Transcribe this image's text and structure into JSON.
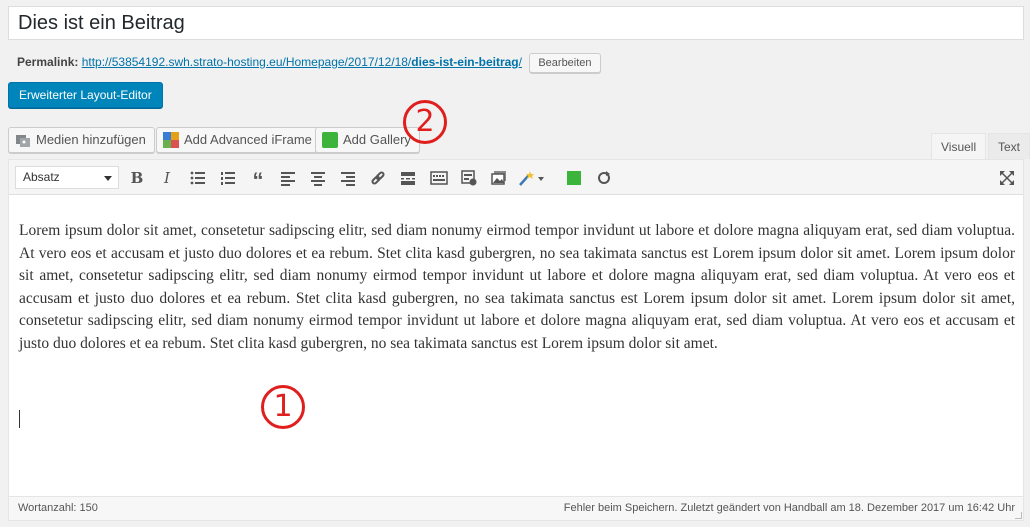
{
  "post": {
    "title": "Dies ist ein Beitrag",
    "permalink_label": "Permalink:",
    "permalink_base": "http://53854192.swh.strato-hosting.eu/Homepage/2017/12/18/",
    "permalink_slug": "dies-ist-ein-beitrag",
    "permalink_trailing": "/",
    "edit_slug_label": "Bearbeiten"
  },
  "layout_editor_label": "Erweiterter Layout-Editor",
  "media_buttons": {
    "add_media": "Medien hinzufügen",
    "add_iframe": "Add Advanced iFrame",
    "add_gallery": "Add Gallery"
  },
  "tabs": {
    "visual": "Visuell",
    "text": "Text"
  },
  "toolbar": {
    "format_select": "Absatz",
    "icons": [
      "bold-icon",
      "italic-icon",
      "bullet-list-icon",
      "numbered-list-icon",
      "blockquote-icon",
      "align-left-icon",
      "align-center-icon",
      "align-right-icon",
      "link-icon",
      "read-more-icon",
      "toolbar-toggle-icon",
      "shortcode-icon",
      "image-icon",
      "magic-wand-icon",
      "green-square-icon",
      "refresh-icon",
      "fullscreen-icon"
    ]
  },
  "content": {
    "paragraph": "Lorem ipsum dolor sit amet, consetetur sadipscing elitr, sed diam nonumy eirmod tempor invidunt ut labore et dolore magna aliquyam erat, sed diam voluptua. At vero eos et accusam et justo duo dolores et ea rebum. Stet clita kasd gubergren, no sea takimata sanctus est Lorem ipsum dolor sit amet. Lorem ipsum dolor sit amet, consetetur sadipscing elitr, sed diam nonumy eirmod tempor invidunt ut labore et dolore magna aliquyam erat, sed diam voluptua. At vero eos et accusam et justo duo dolores et ea rebum. Stet clita kasd gubergren, no sea takimata sanctus est Lorem ipsum dolor sit amet. Lorem ipsum dolor sit amet, consetetur sadipscing elitr, sed diam nonumy eirmod tempor invidunt ut labore et dolore magna aliquyam erat, sed diam voluptua. At vero eos et accusam et justo duo dolores et ea rebum. Stet clita kasd gubergren, no sea takimata sanctus est Lorem ipsum dolor sit amet."
  },
  "status": {
    "word_count": "Wortanzahl: 150",
    "save_status": "Fehler beim Speichern. Zuletzt geändert von Handball am 18. Dezember 2017 um 16:42 Uhr"
  },
  "annotations": {
    "one": "1",
    "two": "2"
  },
  "colors": {
    "primary": "#0085ba",
    "link": "#0073aa",
    "annotation": "#e01e1e"
  }
}
